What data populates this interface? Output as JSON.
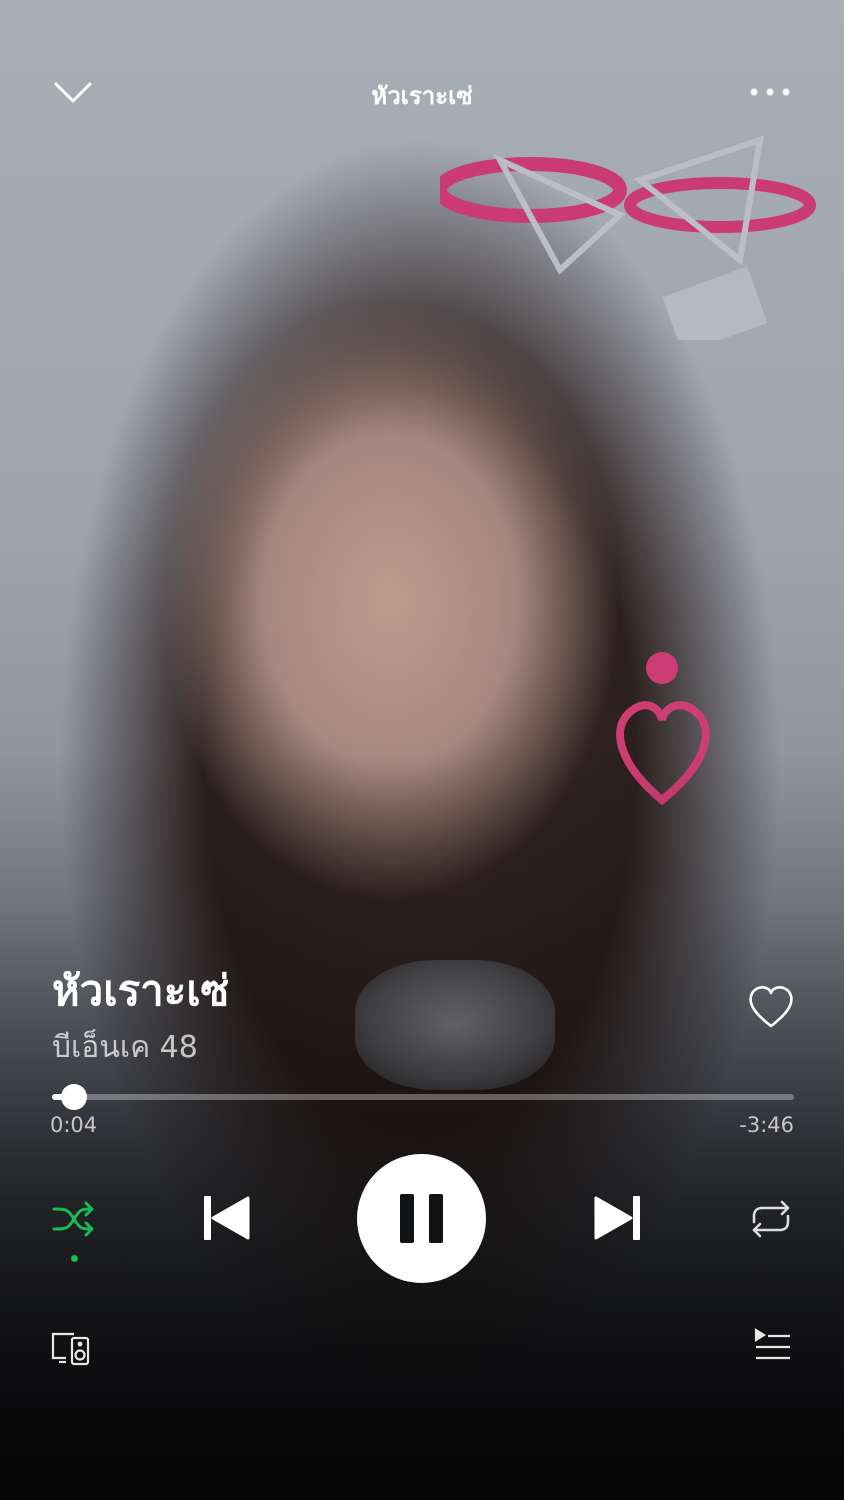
{
  "header": {
    "title": "หัวเราะเซ่"
  },
  "track": {
    "title": "หัวเราะเซ่",
    "artist": "บีเอ็นเค 48"
  },
  "progress": {
    "elapsed": "0:04",
    "remaining": "-3:46",
    "fraction": 0.03
  },
  "controls": {
    "shuffle_active": true,
    "state": "playing"
  },
  "icons": {
    "collapse": "chevron-down-icon",
    "more": "more-horizontal-icon",
    "like": "heart-outline-icon",
    "shuffle": "shuffle-icon",
    "previous": "skip-previous-icon",
    "pause": "pause-icon",
    "next": "skip-next-icon",
    "repeat": "repeat-icon",
    "devices": "connect-devices-icon",
    "queue": "queue-icon"
  },
  "colors": {
    "accent": "#1db954",
    "text_primary": "#ffffff",
    "text_secondary": "#b8b8bc"
  }
}
